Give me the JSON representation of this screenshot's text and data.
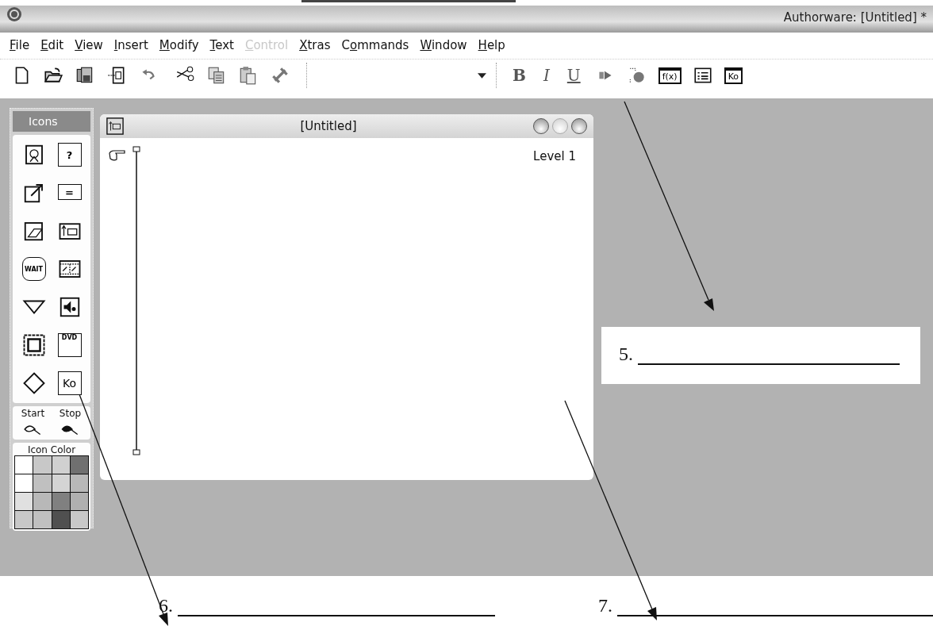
{
  "window": {
    "title": "Authorware: [Untitled] *"
  },
  "menu": [
    {
      "key": "F",
      "post": "ile",
      "disabled": false
    },
    {
      "key": "E",
      "post": "dit",
      "disabled": false
    },
    {
      "key": "V",
      "post": "iew",
      "disabled": false
    },
    {
      "key": "I",
      "post": "nsert",
      "disabled": false
    },
    {
      "key": "M",
      "post": "odify",
      "disabled": false
    },
    {
      "key": "T",
      "post": "ext",
      "disabled": false
    },
    {
      "key": "C",
      "post": "ontrol",
      "disabled": true
    },
    {
      "key": "X",
      "post": "tras",
      "disabled": false
    },
    {
      "pre": "C",
      "key": "o",
      "post": "mmands",
      "disabled": false
    },
    {
      "key": "W",
      "post": "indow",
      "disabled": false
    },
    {
      "key": "H",
      "post": "elp",
      "disabled": false
    }
  ],
  "toolbar": [
    {
      "kind": "new"
    },
    {
      "kind": "open"
    },
    {
      "kind": "save"
    },
    {
      "kind": "import"
    },
    {
      "kind": "undo"
    },
    {
      "kind": "cut"
    },
    {
      "kind": "copy"
    },
    {
      "kind": "paste"
    },
    {
      "kind": "find"
    },
    {
      "kind": "font"
    },
    {
      "kind": "bold",
      "text": "B"
    },
    {
      "kind": "italic",
      "text": "I"
    },
    {
      "kind": "underline",
      "text": "U"
    },
    {
      "kind": "play"
    },
    {
      "kind": "control"
    },
    {
      "kind": "boxed",
      "text": "f(x)"
    },
    {
      "kind": "list"
    },
    {
      "kind": "boxed",
      "text": "Ko"
    }
  ],
  "icon_palette": {
    "title": "Icons",
    "tools": [
      {
        "kind": "display"
      },
      {
        "kind": "interaction",
        "text": "?"
      },
      {
        "kind": "motion"
      },
      {
        "kind": "calculation",
        "text": "="
      },
      {
        "kind": "erase"
      },
      {
        "kind": "map"
      },
      {
        "kind": "wait",
        "text": "WAIT"
      },
      {
        "kind": "movie"
      },
      {
        "kind": "navigate"
      },
      {
        "kind": "sound"
      },
      {
        "kind": "framework"
      },
      {
        "kind": "dvd",
        "text": "DVD"
      },
      {
        "kind": "decision"
      },
      {
        "kind": "knowledge",
        "text": "Ko"
      }
    ],
    "flags": [
      {
        "label": "Start",
        "kind": "start"
      },
      {
        "label": "Stop",
        "kind": "stop"
      }
    ],
    "color_title": "Icon Color",
    "colors": [
      {
        "color": "#ffffff"
      },
      {
        "color": "#c8c8c8"
      },
      {
        "color": "#d0d0d0"
      },
      {
        "color": "#707070"
      },
      {
        "color": "#ffffff"
      },
      {
        "color": "#c0c0c0"
      },
      {
        "color": "#d4d4d4"
      },
      {
        "color": "#b8b8b8"
      },
      {
        "color": "#e0e0e0"
      },
      {
        "color": "#b8b8b8"
      },
      {
        "color": "#808080"
      },
      {
        "color": "#b0b0b0"
      },
      {
        "color": "#c8c8c8"
      },
      {
        "color": "#c0c0c0"
      },
      {
        "color": "#505050"
      },
      {
        "color": "#c8c8c8"
      }
    ]
  },
  "design_window": {
    "title": "[Untitled]",
    "level": "Level 1"
  },
  "answer_blanks": [
    {
      "number": "5."
    },
    {
      "number": "6."
    },
    {
      "number": "7."
    }
  ]
}
